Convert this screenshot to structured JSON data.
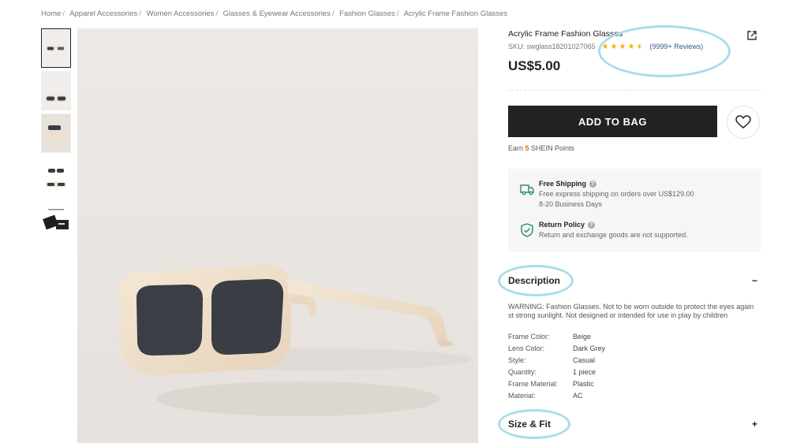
{
  "breadcrumb": [
    {
      "label": "Home"
    },
    {
      "label": "Apparel Accessories"
    },
    {
      "label": "Women Accessories"
    },
    {
      "label": "Glasses & Eyewear Accessories"
    },
    {
      "label": "Fashion Glasses"
    },
    {
      "label": "Acrylic Frame Fashion Glasses"
    }
  ],
  "product": {
    "title": "Acrylic Frame Fashion Glasses",
    "sku": "SKU: swglass18201027065",
    "rating": 4.5,
    "reviews": "(9999+ Reviews)",
    "price": "US$5.00"
  },
  "actions": {
    "add_to_bag": "ADD TO BAG",
    "points_prefix": "Earn ",
    "points_value": "5",
    "points_suffix": " SHEIN Points"
  },
  "service": {
    "shipping_title": "Free Shipping",
    "shipping_line1": "Free express shipping on orders over US$129.00",
    "shipping_line2": "8-20 Business Days",
    "return_title": "Return Policy",
    "return_line1": "Return and exchange goods are not supported."
  },
  "description": {
    "heading": "Description",
    "toggle": "−",
    "warning_line1": "WARNING: Fashion Glasses. Not to be worn outside to protect the eyes again",
    "warning_line2": "st strong sunlight. Not designed or intended for use in play by children",
    "attributes": [
      {
        "key": "Frame Color:",
        "value": "Beige"
      },
      {
        "key": "Lens Color:",
        "value": "Dark Grey"
      },
      {
        "key": "Style:",
        "value": "Casual"
      },
      {
        "key": "Quantity:",
        "value": "1 piece"
      },
      {
        "key": "Frame Material:",
        "value": "Plastic"
      },
      {
        "key": "Material:",
        "value": "AC"
      }
    ]
  },
  "size_fit": {
    "heading": "Size & Fit",
    "toggle": "+"
  },
  "thumbnails": [
    {
      "name": "front-view"
    },
    {
      "name": "flat-view"
    },
    {
      "name": "side-view"
    },
    {
      "name": "multi-view"
    },
    {
      "name": "packaging-view"
    }
  ],
  "colors": {
    "frame": "#efdfca",
    "lens": "#3b3d44",
    "button": "#222222",
    "stars": "#f5b400",
    "link": "#2a5b8c",
    "highlight": "#a8dcec",
    "shipping_icon": "#2e8b57"
  }
}
